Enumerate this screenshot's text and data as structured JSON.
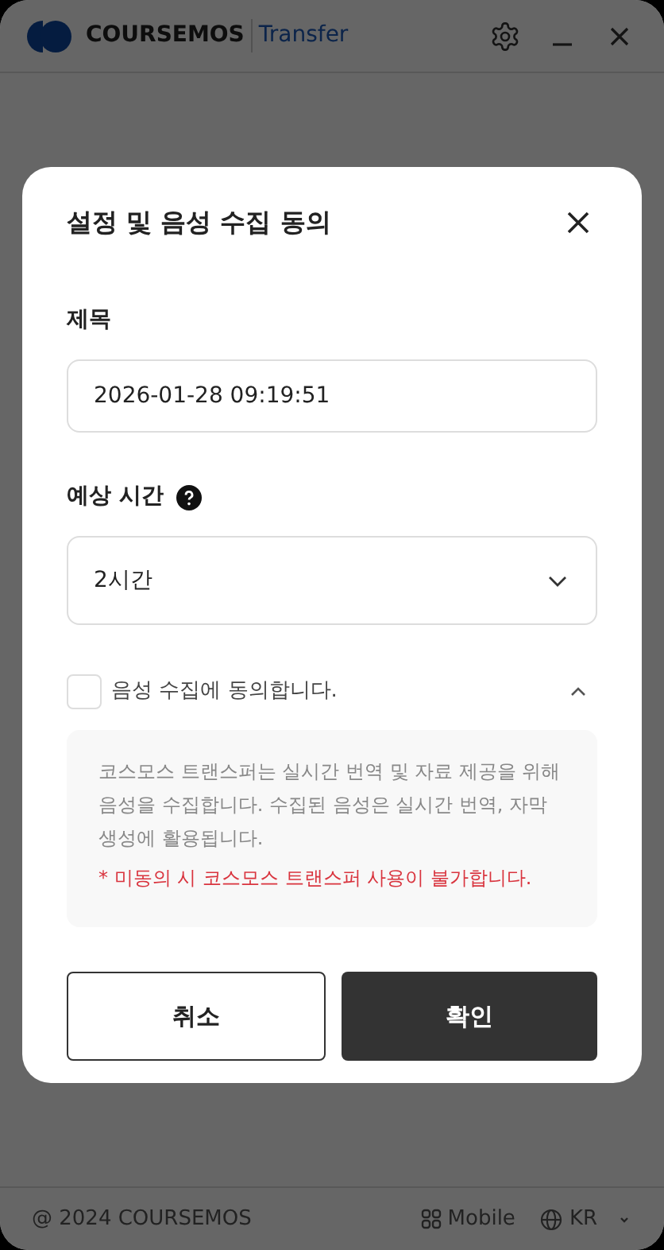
{
  "header": {
    "brand": "COURSEMOS",
    "product": "Transfer"
  },
  "dialog": {
    "title": "설정 및 음성 수집 동의",
    "title_field": {
      "label": "제목",
      "value": "2026-01-28 09:19:51"
    },
    "duration_field": {
      "label": "예상 시간",
      "value": "2시간"
    },
    "consent": {
      "label": "음성 수집에 동의합니다.",
      "checked": false,
      "expanded": true,
      "description": "코스모스 트랜스퍼는 실시간 번역 및 자료 제공을 위해 음성을 수집합니다. 수집된 음성은 실시간 번역, 자막 생성에 활용됩니다.",
      "warning": "* 미동의 시 코스모스 트랜스퍼 사용이 불가합니다."
    },
    "buttons": [
      {
        "label": "취소",
        "kind": "secondary"
      },
      {
        "label": "확인",
        "kind": "primary"
      }
    ]
  },
  "footer": {
    "copyright": "@ 2024 COURSEMOS",
    "mobile": "Mobile",
    "language": "KR"
  }
}
